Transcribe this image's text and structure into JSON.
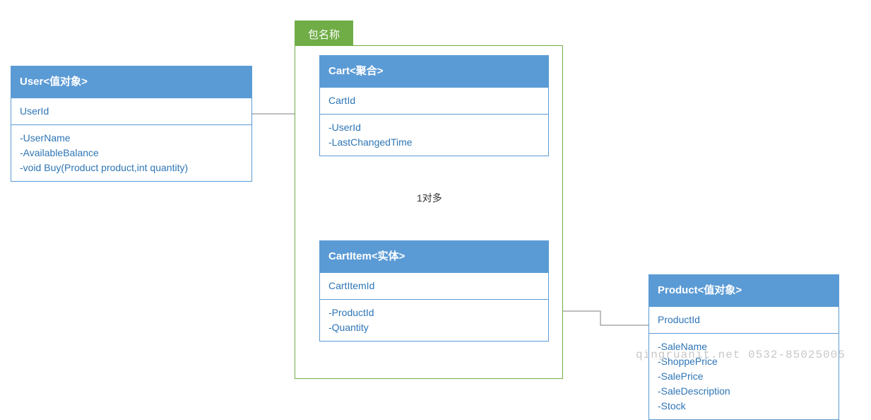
{
  "package": {
    "label": "包名称"
  },
  "classes": {
    "user": {
      "title": "User<值对象>",
      "id_field": "UserId",
      "attrs": [
        "-UserName",
        "-AvailableBalance",
        "-void Buy(Product product,int quantity)"
      ]
    },
    "cart": {
      "title": "Cart<聚合>",
      "id_field": "CartId",
      "attrs": [
        "-UserId",
        "-LastChangedTime"
      ]
    },
    "cartitem": {
      "title": "CartItem<实体>",
      "id_field": "CartItemId",
      "attrs": [
        "-ProductId",
        "-Quantity"
      ]
    },
    "product": {
      "title": "Product<值对象>",
      "id_field": "ProductId",
      "attrs": [
        "-SaleName",
        "-ShoppePrice",
        "-SalePrice",
        "-SaleDescription",
        "-Stock"
      ]
    }
  },
  "relations": {
    "cart_cartitem_label": "1对多"
  },
  "watermark": "qingruanit.net 0532-85025005"
}
